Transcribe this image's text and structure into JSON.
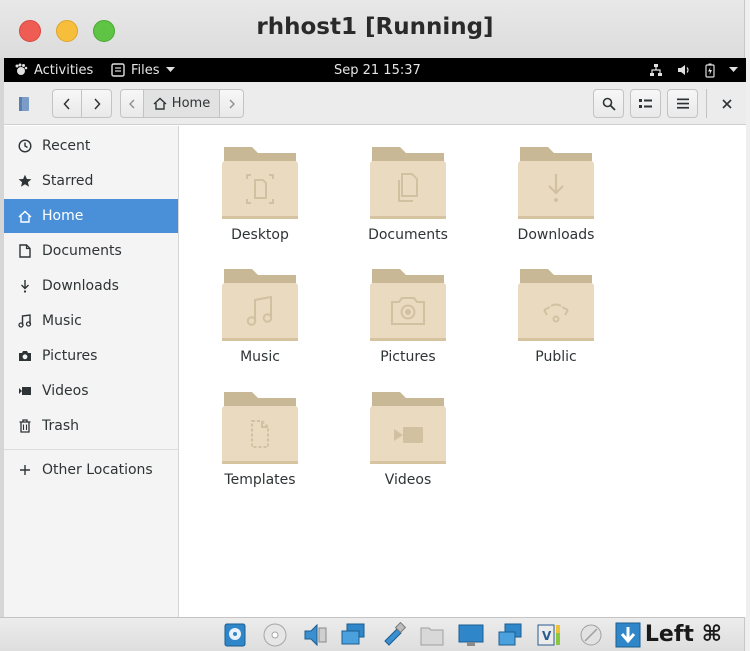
{
  "window": {
    "title": "rhhost1 [Running]"
  },
  "topbar": {
    "activities_label": "Activities",
    "app_menu_label": "Files",
    "clock": "Sep 21  15:37"
  },
  "headerbar": {
    "path_home_label": "Home"
  },
  "sidebar": {
    "items": [
      {
        "label": "Recent",
        "icon": "clock-icon"
      },
      {
        "label": "Starred",
        "icon": "star-icon"
      },
      {
        "label": "Home",
        "icon": "home-icon",
        "active": true
      },
      {
        "label": "Documents",
        "icon": "document-icon"
      },
      {
        "label": "Downloads",
        "icon": "download-icon"
      },
      {
        "label": "Music",
        "icon": "music-icon"
      },
      {
        "label": "Pictures",
        "icon": "camera-icon"
      },
      {
        "label": "Videos",
        "icon": "video-icon"
      },
      {
        "label": "Trash",
        "icon": "trash-icon"
      }
    ],
    "other_locations_label": "Other Locations"
  },
  "folders": [
    {
      "label": "Desktop",
      "emblem": "desktop"
    },
    {
      "label": "Documents",
      "emblem": "documents"
    },
    {
      "label": "Downloads",
      "emblem": "downloads"
    },
    {
      "label": "Music",
      "emblem": "music"
    },
    {
      "label": "Pictures",
      "emblem": "pictures"
    },
    {
      "label": "Public",
      "emblem": "public"
    },
    {
      "label": "Templates",
      "emblem": "templates"
    },
    {
      "label": "Videos",
      "emblem": "videos"
    }
  ],
  "statusbar": {
    "host_key_label": "Left ⌘"
  },
  "colors": {
    "accent": "#4a90d9",
    "folder_body": "#eadac0",
    "folder_tab": "#c9b895"
  }
}
